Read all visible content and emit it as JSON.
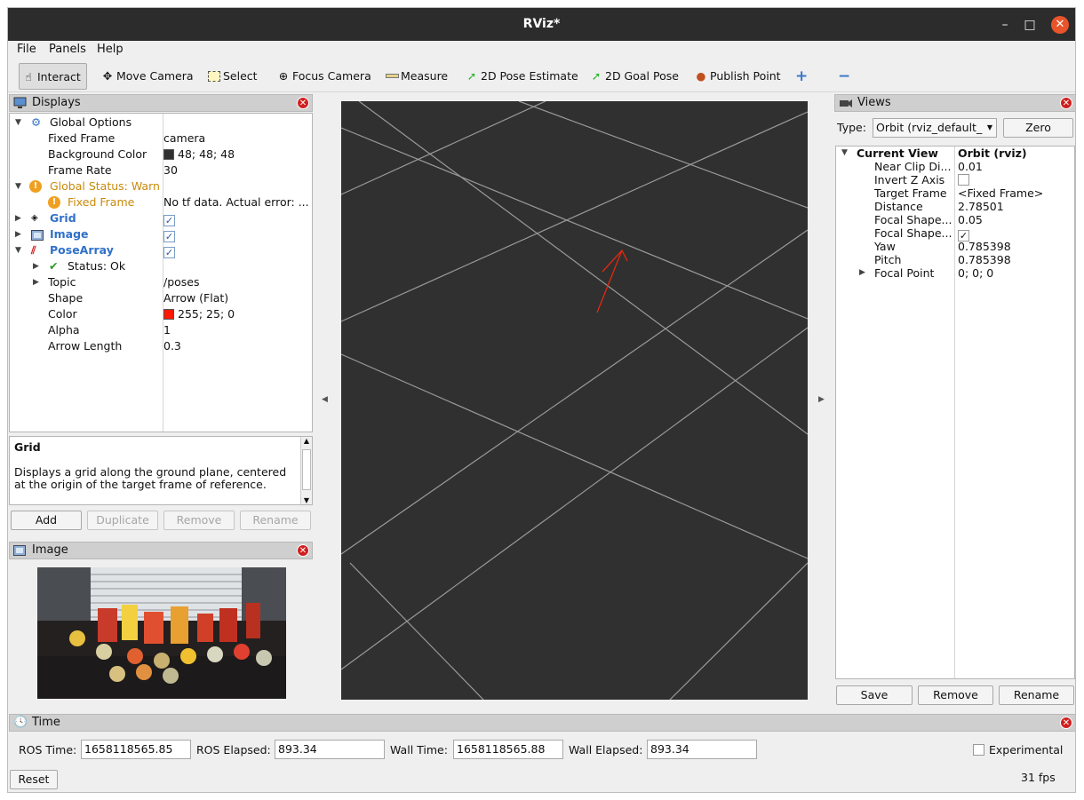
{
  "window": {
    "title": "RViz*",
    "minimize": "–",
    "maximize": "□",
    "close": "✕"
  },
  "menu": [
    "File",
    "Panels",
    "Help"
  ],
  "toolbar": [
    {
      "label": "Interact",
      "icon": "cursor-icon"
    },
    {
      "label": "Move Camera",
      "icon": "move-icon"
    },
    {
      "label": "Select",
      "icon": "select-box-icon"
    },
    {
      "label": "Focus Camera",
      "icon": "crosshair-icon"
    },
    {
      "label": "Measure",
      "icon": "ruler-icon"
    },
    {
      "label": "2D Pose Estimate",
      "icon": "green-arrow-icon"
    },
    {
      "label": "2D Goal Pose",
      "icon": "green-arrow-icon"
    },
    {
      "label": "Publish Point",
      "icon": "map-pin-icon"
    }
  ],
  "displays": {
    "title": "Displays",
    "global_options": "Global Options",
    "fixed_frame": {
      "label": "Fixed Frame",
      "value": "camera"
    },
    "background_color": {
      "label": "Background Color",
      "value": "48; 48; 48",
      "swatch": "#303030"
    },
    "frame_rate": {
      "label": "Frame Rate",
      "value": "30"
    },
    "global_status": "Global Status: Warn",
    "fixed_frame_status": {
      "label": "Fixed Frame",
      "value": "No tf data.  Actual error: ..."
    },
    "grid": "Grid",
    "image": "Image",
    "pose_array": "PoseArray",
    "status_ok": "Status: Ok",
    "topic": {
      "label": "Topic",
      "value": "/poses"
    },
    "shape": {
      "label": "Shape",
      "value": "Arrow (Flat)"
    },
    "color": {
      "label": "Color",
      "value": "255; 25; 0",
      "swatch": "#ff1900"
    },
    "alpha": {
      "label": "Alpha",
      "value": "1"
    },
    "arrow_length": {
      "label": "Arrow Length",
      "value": "0.3"
    },
    "check": "✓"
  },
  "description": {
    "title": "Grid",
    "text": "Displays a grid along the ground plane, centered at the origin of the target frame of reference."
  },
  "display_buttons": {
    "add": "Add",
    "duplicate": "Duplicate",
    "remove": "Remove",
    "rename": "Rename"
  },
  "image_panel": {
    "title": "Image"
  },
  "views": {
    "title": "Views",
    "type_label": "Type:",
    "type_value": "Orbit (rviz_default_",
    "zero": "Zero",
    "current_view": "Current View",
    "current_view_value": "Orbit (rviz)",
    "rows": [
      {
        "label": "Near Clip Di...",
        "value": "0.01"
      },
      {
        "label": "Invert Z Axis",
        "value": ""
      },
      {
        "label": "Target Frame",
        "value": "<Fixed Frame>"
      },
      {
        "label": "Distance",
        "value": "2.78501"
      },
      {
        "label": "Focal Shape...",
        "value": "0.05"
      },
      {
        "label": "Focal Shape...",
        "value": "✓"
      },
      {
        "label": "Yaw",
        "value": "0.785398"
      },
      {
        "label": "Pitch",
        "value": "0.785398"
      },
      {
        "label": "Focal Point",
        "value": "0; 0; 0"
      }
    ],
    "save": "Save",
    "remove": "Remove",
    "rename": "Rename"
  },
  "time": {
    "title": "Time",
    "ros_time_label": "ROS Time:",
    "ros_time": "1658118565.85",
    "ros_elapsed_label": "ROS Elapsed:",
    "ros_elapsed": "893.34",
    "wall_time_label": "Wall Time:",
    "wall_time": "1658118565.88",
    "wall_elapsed_label": "Wall Elapsed:",
    "wall_elapsed": "893.34",
    "experimental": "Experimental",
    "reset": "Reset",
    "fps": "31 fps"
  }
}
